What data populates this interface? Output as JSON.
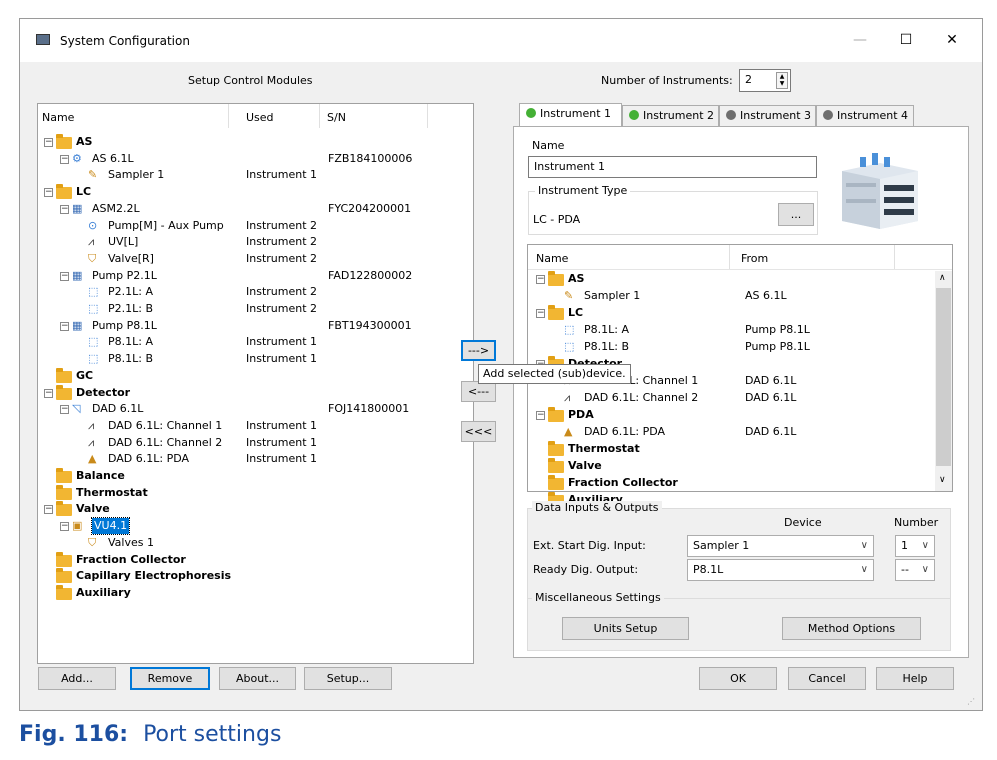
{
  "window": {
    "title": "System Configuration"
  },
  "left": {
    "heading": "Setup Control Modules",
    "columns": [
      "Name",
      "Used",
      "S/N"
    ],
    "rows": [
      {
        "label": "AS",
        "used": "",
        "sn": "",
        "bold": true,
        "type": "folder",
        "indent": 0,
        "exp": "-"
      },
      {
        "label": "AS 6.1L",
        "used": "",
        "sn": "FZB184100006",
        "bold": false,
        "type": "as",
        "indent": 1,
        "exp": "-"
      },
      {
        "label": "Sampler 1",
        "used": "Instrument 1",
        "sn": "",
        "bold": false,
        "type": "sampler",
        "indent": 2,
        "exp": ""
      },
      {
        "label": "LC",
        "used": "",
        "sn": "",
        "bold": true,
        "type": "folder",
        "indent": 0,
        "exp": "-"
      },
      {
        "label": "ASM2.2L",
        "used": "",
        "sn": "FYC204200001",
        "bold": false,
        "type": "box",
        "indent": 1,
        "exp": "-"
      },
      {
        "label": "Pump[M] - Aux Pump",
        "used": "Instrument 2",
        "sn": "",
        "bold": false,
        "type": "pump",
        "indent": 2,
        "exp": ""
      },
      {
        "label": "UV[L]",
        "used": "Instrument 2",
        "sn": "",
        "bold": false,
        "type": "uv",
        "indent": 2,
        "exp": ""
      },
      {
        "label": "Valve[R]",
        "used": "Instrument 2",
        "sn": "",
        "bold": false,
        "type": "valve",
        "indent": 2,
        "exp": ""
      },
      {
        "label": "Pump P2.1L",
        "used": "",
        "sn": "FAD122800002",
        "bold": false,
        "type": "box",
        "indent": 1,
        "exp": "-"
      },
      {
        "label": "P2.1L: A",
        "used": "Instrument 2",
        "sn": "",
        "bold": false,
        "type": "pumphead",
        "indent": 2,
        "exp": ""
      },
      {
        "label": "P2.1L: B",
        "used": "Instrument 2",
        "sn": "",
        "bold": false,
        "type": "pumphead",
        "indent": 2,
        "exp": ""
      },
      {
        "label": "Pump P8.1L",
        "used": "",
        "sn": "FBT194300001",
        "bold": false,
        "type": "box",
        "indent": 1,
        "exp": "-"
      },
      {
        "label": "P8.1L: A",
        "used": "Instrument 1",
        "sn": "",
        "bold": false,
        "type": "pumphead",
        "indent": 2,
        "exp": ""
      },
      {
        "label": "P8.1L: B",
        "used": "Instrument 1",
        "sn": "",
        "bold": false,
        "type": "pumphead",
        "indent": 2,
        "exp": ""
      },
      {
        "label": "GC",
        "used": "",
        "sn": "",
        "bold": true,
        "type": "folder",
        "indent": 0,
        "exp": ""
      },
      {
        "label": "Detector",
        "used": "",
        "sn": "",
        "bold": true,
        "type": "folder",
        "indent": 0,
        "exp": "-"
      },
      {
        "label": "DAD 6.1L",
        "used": "",
        "sn": "FOJ141800001",
        "bold": false,
        "type": "dad",
        "indent": 1,
        "exp": "-"
      },
      {
        "label": "DAD 6.1L: Channel 1",
        "used": "Instrument 1",
        "sn": "",
        "bold": false,
        "type": "uv",
        "indent": 2,
        "exp": ""
      },
      {
        "label": "DAD 6.1L: Channel 2",
        "used": "Instrument 1",
        "sn": "",
        "bold": false,
        "type": "uv",
        "indent": 2,
        "exp": ""
      },
      {
        "label": "DAD 6.1L: PDA",
        "used": "Instrument 1",
        "sn": "",
        "bold": false,
        "type": "pda",
        "indent": 2,
        "exp": ""
      },
      {
        "label": "Balance",
        "used": "",
        "sn": "",
        "bold": true,
        "type": "folder",
        "indent": 0,
        "exp": ""
      },
      {
        "label": "Thermostat",
        "used": "",
        "sn": "",
        "bold": true,
        "type": "folder",
        "indent": 0,
        "exp": ""
      },
      {
        "label": "Valve",
        "used": "",
        "sn": "",
        "bold": true,
        "type": "folder",
        "indent": 0,
        "exp": "-"
      },
      {
        "label": "VU4.1",
        "used": "",
        "sn": "",
        "bold": false,
        "type": "vu",
        "indent": 1,
        "exp": "-",
        "selected": true
      },
      {
        "label": "Valves 1",
        "used": "",
        "sn": "",
        "bold": false,
        "type": "valve",
        "indent": 2,
        "exp": ""
      },
      {
        "label": "Fraction Collector",
        "used": "",
        "sn": "",
        "bold": true,
        "type": "folder",
        "indent": 0,
        "exp": ""
      },
      {
        "label": "Capillary Electrophoresis",
        "used": "",
        "sn": "",
        "bold": true,
        "type": "folder",
        "indent": 0,
        "exp": ""
      },
      {
        "label": "Auxiliary",
        "used": "",
        "sn": "",
        "bold": true,
        "type": "folder",
        "indent": 0,
        "exp": ""
      }
    ],
    "buttons": {
      "add": "Add...",
      "remove": "Remove",
      "about": "About...",
      "setup": "Setup..."
    }
  },
  "middle": {
    "add_btn": "--->",
    "remove_btn": "<---",
    "remove_all_btn": "<<<",
    "tooltip": "Add selected (sub)device."
  },
  "right": {
    "num_instruments_label": "Number of Instruments:",
    "num_instruments_value": "2",
    "tabs": [
      {
        "label": "Instrument 1",
        "status": "green",
        "active": true
      },
      {
        "label": "Instrument 2",
        "status": "green",
        "active": false
      },
      {
        "label": "Instrument 3",
        "status": "gray",
        "active": false
      },
      {
        "label": "Instrument 4",
        "status": "gray",
        "active": false
      }
    ],
    "name_label": "Name",
    "name_value": "Instrument 1",
    "instrument_type_label": "Instrument Type",
    "instrument_type_value": "LC - PDA",
    "browse_btn": "...",
    "tree_columns": [
      "Name",
      "From"
    ],
    "tree_rows": [
      {
        "label": "AS",
        "from": "",
        "bold": true,
        "type": "folder",
        "indent": 0,
        "exp": "-"
      },
      {
        "label": "Sampler 1",
        "from": "AS 6.1L",
        "bold": false,
        "type": "sampler",
        "indent": 1,
        "exp": ""
      },
      {
        "label": "LC",
        "from": "",
        "bold": true,
        "type": "folder",
        "indent": 0,
        "exp": "-"
      },
      {
        "label": "P8.1L: A",
        "from": "Pump P8.1L",
        "bold": false,
        "type": "pumphead",
        "indent": 1,
        "exp": ""
      },
      {
        "label": "P8.1L: B",
        "from": "Pump P8.1L",
        "bold": false,
        "type": "pumphead",
        "indent": 1,
        "exp": ""
      },
      {
        "label": "Detector",
        "from": "",
        "bold": true,
        "type": "folder",
        "indent": 0,
        "exp": "-"
      },
      {
        "label": "DAD 6.1L: Channel 1",
        "from": "DAD 6.1L",
        "bold": false,
        "type": "uv",
        "indent": 1,
        "exp": ""
      },
      {
        "label": "DAD 6.1L: Channel 2",
        "from": "DAD 6.1L",
        "bold": false,
        "type": "uv",
        "indent": 1,
        "exp": ""
      },
      {
        "label": "PDA",
        "from": "",
        "bold": true,
        "type": "folder",
        "indent": 0,
        "exp": "-"
      },
      {
        "label": "DAD 6.1L: PDA",
        "from": "DAD 6.1L",
        "bold": false,
        "type": "pda",
        "indent": 1,
        "exp": ""
      },
      {
        "label": "Thermostat",
        "from": "",
        "bold": true,
        "type": "folder",
        "indent": 0,
        "exp": ""
      },
      {
        "label": "Valve",
        "from": "",
        "bold": true,
        "type": "folder",
        "indent": 0,
        "exp": ""
      },
      {
        "label": "Fraction Collector",
        "from": "",
        "bold": true,
        "type": "folder",
        "indent": 0,
        "exp": ""
      },
      {
        "label": "Auxiliary",
        "from": "",
        "bold": true,
        "type": "folder",
        "indent": 0,
        "exp": ""
      }
    ],
    "io_group_title": "Data Inputs & Outputs",
    "io_device_header": "Device",
    "io_number_header": "Number",
    "io_rows": [
      {
        "label": "Ext. Start Dig. Input:",
        "device": "Sampler 1",
        "number": "1"
      },
      {
        "label": "Ready Dig. Output:",
        "device": "P8.1L",
        "number": "--"
      }
    ],
    "misc_group_title": "Miscellaneous Settings",
    "units_btn": "Units Setup",
    "method_btn": "Method Options"
  },
  "footer": {
    "ok": "OK",
    "cancel": "Cancel",
    "help": "Help"
  },
  "caption": {
    "number": "Fig. 116:",
    "text": "Port settings"
  },
  "colors": {
    "accent": "#0078d7",
    "caption": "#1c4fa0",
    "folder": "#f2b632",
    "status_green": "#44b035",
    "status_gray": "#6e6e6e"
  }
}
